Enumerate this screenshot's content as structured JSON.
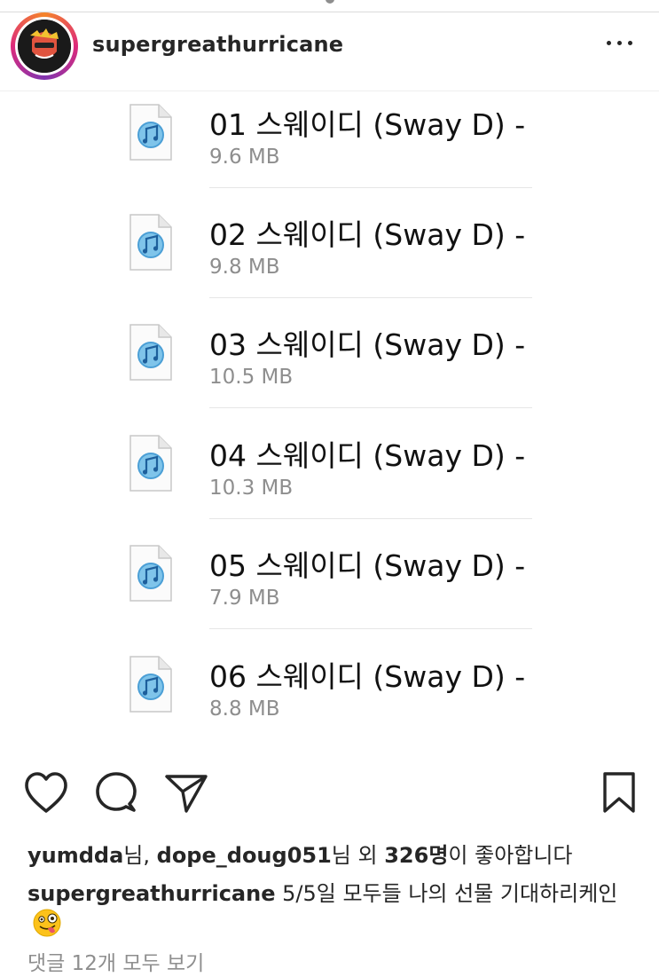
{
  "header": {
    "username": "supergreathurricane",
    "more_icon": "ellipsis-horizontal-icon"
  },
  "files": [
    {
      "name": "01 스웨이디 (Sway D) -",
      "size": "9.6 MB",
      "icon": "audio-file-icon"
    },
    {
      "name": "02 스웨이디 (Sway D) -",
      "size": "9.8 MB",
      "icon": "audio-file-icon"
    },
    {
      "name": "03 스웨이디 (Sway D) -",
      "size": "10.5 MB",
      "icon": "audio-file-icon"
    },
    {
      "name": "04 스웨이디 (Sway D) -",
      "size": "10.3 MB",
      "icon": "audio-file-icon"
    },
    {
      "name": "05 스웨이디 (Sway D) -",
      "size": "7.9 MB",
      "icon": "audio-file-icon"
    },
    {
      "name": "06 스웨이디 (Sway D) -",
      "size": "8.8 MB",
      "icon": "audio-file-icon"
    }
  ],
  "actions": {
    "like_icon": "heart-icon",
    "comment_icon": "comment-bubble-icon",
    "share_icon": "paper-plane-icon",
    "save_icon": "bookmark-icon"
  },
  "likes": {
    "user1": "yumdda",
    "sep1": "님, ",
    "user2": "dope_doug051",
    "sep2": "님 외 ",
    "count": "326명",
    "suffix": "이 좋아합니다"
  },
  "caption": {
    "username": "supergreathurricane",
    "text": " 5/5일 모두들 나의 선물 기대하리케인",
    "emoji": "zany-face-emoji"
  },
  "comments_link": "댓글 12개 모두 보기",
  "colors": {
    "text": "#262626",
    "muted": "#8e8e8e",
    "ring_start": "#f58529",
    "ring_mid": "#dd2a7b"
  }
}
